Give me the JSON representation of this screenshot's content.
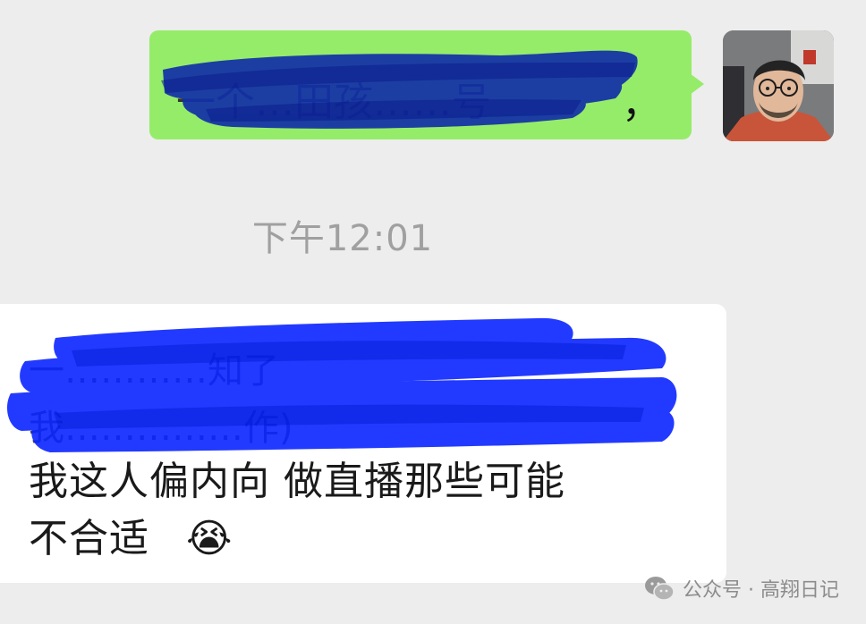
{
  "chat": {
    "outgoing": {
      "text_visible_fragment": "，",
      "redacted_fragment": "一个…田孩……号"
    },
    "timestamp": "下午12:01",
    "incoming": {
      "redacted_line_1": "一…………知了",
      "redacted_line_2": "我……………作)",
      "line_1": "我这人偏内向  做直播那些可能",
      "line_2": "不合适",
      "emoji": "😭"
    }
  },
  "watermark": {
    "label": "公众号 · 高翔日记"
  },
  "colors": {
    "background": "#ededed",
    "outgoing_bubble": "#95ec69",
    "incoming_bubble": "#ffffff",
    "redaction_dark": "#1230a8",
    "redaction_bright": "#0b25ff",
    "timestamp": "#a0a0a0"
  }
}
